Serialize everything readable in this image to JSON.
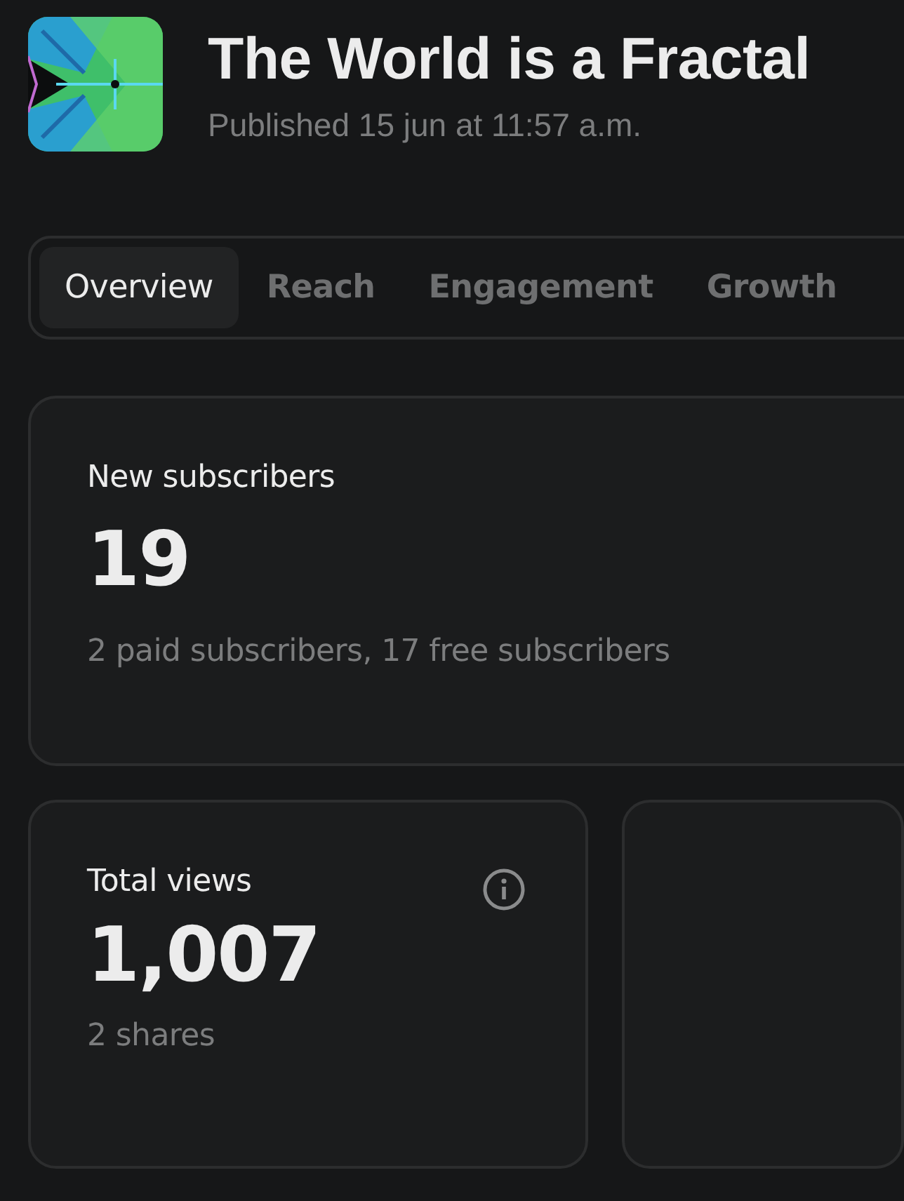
{
  "post": {
    "title": "The World is a Fractal",
    "published": "Published 15 jun at 11:57 a.m."
  },
  "tabs": [
    {
      "label": "Overview",
      "selected": true
    },
    {
      "label": "Reach",
      "selected": false
    },
    {
      "label": "Engagement",
      "selected": false
    },
    {
      "label": "Growth",
      "selected": false
    }
  ],
  "cards": [
    {
      "label": "New subscribers",
      "value": "19",
      "detail": "2 paid subscribers, 17 free subscribers",
      "info": false,
      "wide": true
    },
    {
      "label": "Total views",
      "value": "1,007",
      "detail": "2 shares",
      "info": true,
      "wide": false
    }
  ]
}
